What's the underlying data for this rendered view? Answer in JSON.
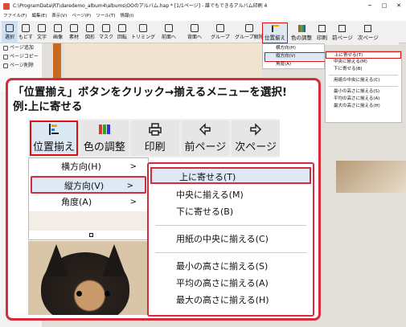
{
  "window": {
    "title": "C:\\ProgramData\\RT\\daredemo_album4\\albums\\OOのアルバム.hap * [1/1ページ] - 誰でもできるアルバム印刷 4",
    "controls": [
      "─",
      "□",
      "✕"
    ]
  },
  "menubar": [
    "ファイル(F)",
    "編集(E)",
    "表示(V)",
    "ページ(P)",
    "ツール(T)",
    "情報(I)"
  ],
  "toolbar": [
    "選択",
    "もどす",
    "文字",
    "画像",
    "素材",
    "図形",
    "マスク",
    "回転",
    "トリミング",
    "前面へ",
    "背面へ",
    "グループ",
    "グループ解除"
  ],
  "sidebar": [
    "ページ追加",
    "ページコピー",
    "ページ削除"
  ],
  "small_toolbar": [
    "位置揃え",
    "色の調整",
    "印刷",
    "前ページ",
    "次ページ"
  ],
  "small_menu1": [
    "横方向(H)",
    "縦方向(V)",
    "角度(A)"
  ],
  "small_menu2": [
    "上に寄せる(T)",
    "中央に揃える(M)",
    "下に寄せる(B)",
    "用紙の中央に揃える(C)",
    "最小の高さに揃える(S)",
    "平均の高さに揃える(A)",
    "最大の高さに揃える(H)"
  ],
  "callout": {
    "line1": "「位置揃え」ボタンをクリック→揃えるメニューを選択!",
    "line2": "例:上に寄せる"
  },
  "big_toolbar": [
    "位置揃え",
    "色の調整",
    "印刷",
    "前ページ",
    "次ページ"
  ],
  "menu1": [
    "横方向(H)",
    "縦方向(V)",
    "角度(A)"
  ],
  "menu1_arrow": ">",
  "menu2": {
    "group1": [
      "上に寄せる(T)",
      "中央に揃える(M)",
      "下に寄せる(B)"
    ],
    "group2": [
      "用紙の中央に揃える(C)"
    ],
    "group3": [
      "最小の高さに揃える(S)",
      "平均の高さに揃える(A)",
      "最大の高さに揃える(H)"
    ]
  },
  "colors": {
    "accent_red": "#d62b3b",
    "highlight_blue": "#dfe8f5"
  }
}
